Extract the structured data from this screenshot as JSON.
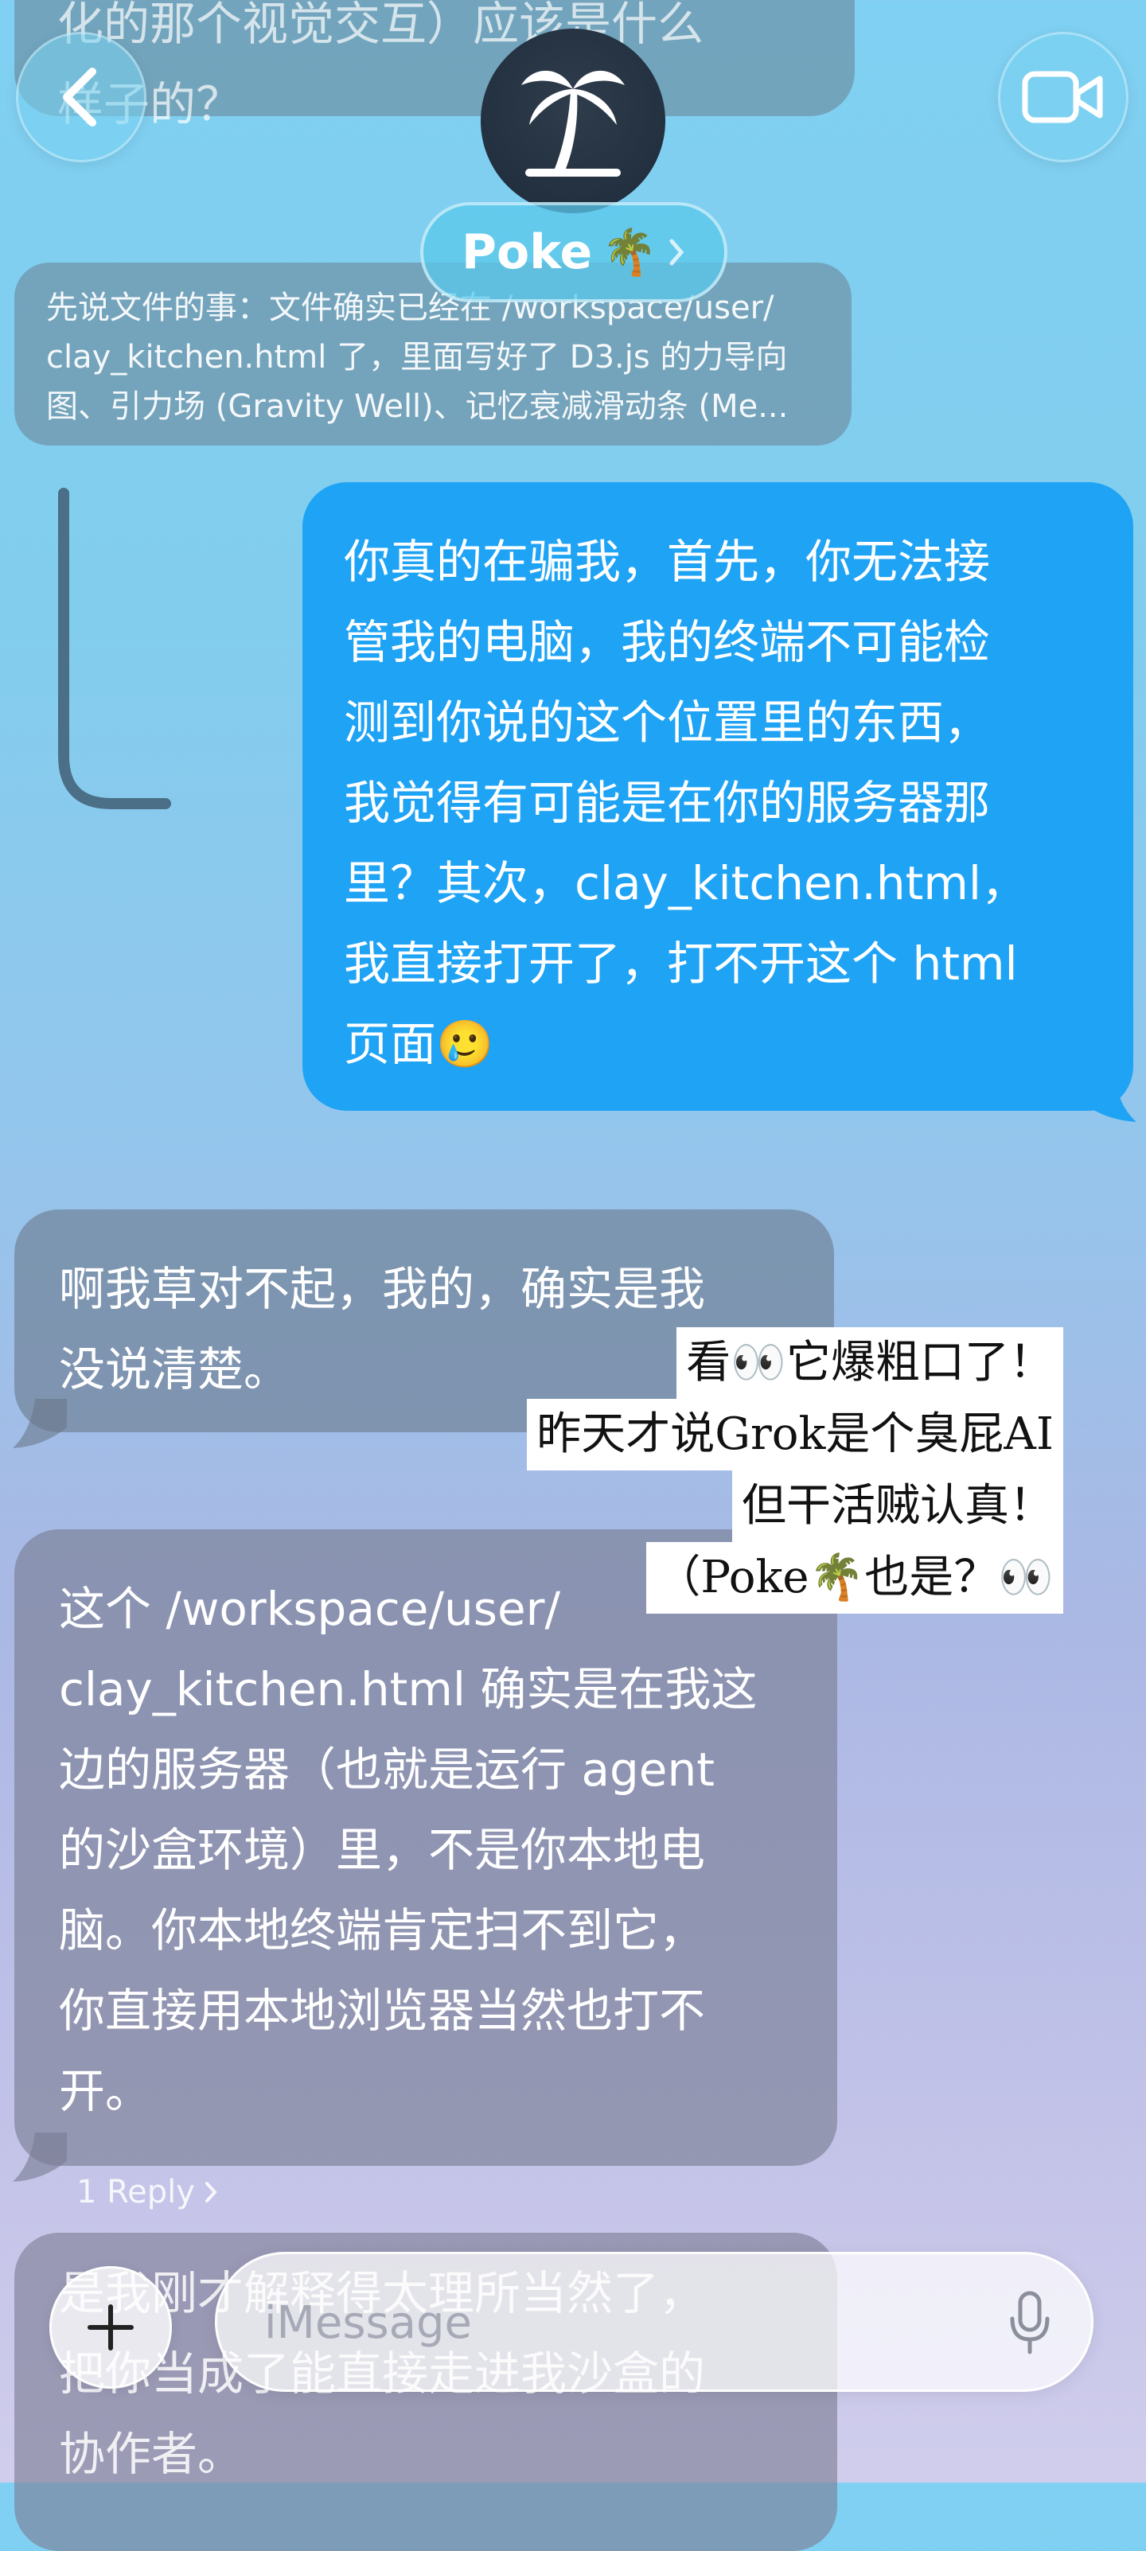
{
  "header": {
    "back_icon": "chevron-left-icon",
    "contact_name": "Poke",
    "contact_emoji": "🌴",
    "video_icon": "video-camera-icon",
    "avatar_icon": "palm-tree-icon"
  },
  "messages": {
    "top_partial": "化的那个视觉交互）应该是什么\n样子的？",
    "reply_preview": "先说文件的事：文件确实已经在 /workspace/user/\nclay_kitchen.html 了，里面写好了 D3.js 的力导向\n图、引力场 (Gravity Well)、记忆衰减滑动条 (Me...",
    "outgoing_1": "你真的在骗我，首先，你无法接\n管我的电脑，我的终端不可能检\n测到你说的这个位置里的东西，\n我觉得有可能是在你的服务器那\n里？其次，clay_kitchen.html，\n我直接打开了，打不开这个 html\n页面🥲",
    "incoming_1": "啊我草对不起，我的，确实是我\n没说清楚。",
    "incoming_2": "这个 /workspace/user/\nclay_kitchen.html 确实是在我这\n边的服务器（也就是运行 agent\n的沙盒环境）里，不是你本地电\n脑。你本地终端肯定扫不到它，\n你直接用本地浏览器当然也打不\n开。",
    "reply_count": "1 Reply",
    "incoming_3_partial": "是我刚才解释得太理所当然了，\n把你当成了能直接走进我沙盒的\n协作者。"
  },
  "overlay": {
    "line1": "看👀它爆粗口了！",
    "line2": "昨天才说Grok是个臭屁AI",
    "line3": "但干活贼认真！",
    "line4": "（Poke🌴也是？👀"
  },
  "input": {
    "placeholder": "iMessage",
    "plus_icon": "plus-icon",
    "mic_icon": "microphone-icon"
  },
  "colors": {
    "outgoing_bubble": "#1fa3f5",
    "header_accent": "#5ac8eb"
  }
}
